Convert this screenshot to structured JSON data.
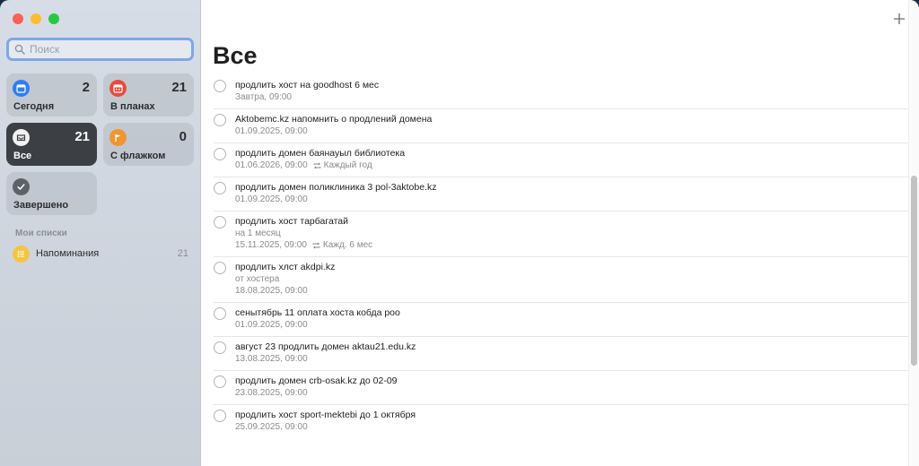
{
  "sidebar": {
    "search_placeholder": "Поиск",
    "cards": [
      {
        "key": "today",
        "label": "Сегодня",
        "count": "2",
        "icon": "calendar-today-icon",
        "color": "#2f7ef5"
      },
      {
        "key": "scheduled",
        "label": "В планах",
        "count": "21",
        "icon": "calendar-icon",
        "color": "#e84a3c"
      },
      {
        "key": "all",
        "label": "Все",
        "count": "21",
        "icon": "tray-icon",
        "color": "#555a60",
        "active": true
      },
      {
        "key": "flagged",
        "label": "С флажком",
        "count": "0",
        "icon": "flag-icon",
        "color": "#f0962e"
      },
      {
        "key": "completed",
        "label": "Завершено",
        "count": "",
        "icon": "checkmark-icon",
        "color": "#5d6168"
      }
    ],
    "my_lists_title": "Мои списки",
    "lists": [
      {
        "label": "Напоминания",
        "count": "21",
        "icon": "list-bullet-icon",
        "color": "#f4c542"
      }
    ]
  },
  "main": {
    "title": "Все",
    "add_icon": "plus-icon",
    "reminders": [
      {
        "title": "продлить хост на goodhost 6 мес",
        "note": "",
        "date": "Завтра, 09:00",
        "repeat": ""
      },
      {
        "title": "Aktobemc.kz напомнить о продлений домена",
        "note": "",
        "date": "01.09.2025, 09:00",
        "repeat": ""
      },
      {
        "title": "продлить домен баянауыл библиотека",
        "note": "",
        "date": "01.06.2026, 09:00",
        "repeat": "Каждый год"
      },
      {
        "title": "продлить домен поликлиника 3 pol-3aktobe.kz",
        "note": "",
        "date": "01.09.2025, 09:00",
        "repeat": ""
      },
      {
        "title": "продлить хост тарбагатай",
        "note": "на 1 месяц",
        "date": "15.11.2025, 09:00",
        "repeat": "Кажд. 6 мес"
      },
      {
        "title": "продлить хлст akdpi.kz",
        "note": "от хостера",
        "date": "18.08.2025, 09:00",
        "repeat": ""
      },
      {
        "title": "сенытябрь 11 оплата хоста кобда роо",
        "note": "",
        "date": "01.09.2025, 09:00",
        "repeat": ""
      },
      {
        "title": "август 23 продлить домен aktau21.edu.kz",
        "note": "",
        "date": "13.08.2025, 09:00",
        "repeat": ""
      },
      {
        "title": "продлить домен crb-osak.kz до 02-09",
        "note": "",
        "date": "23.08.2025, 09:00",
        "repeat": ""
      },
      {
        "title": "продлить хост sport-mektebi до 1 октября",
        "note": "",
        "date": "25.09.2025, 09:00",
        "repeat": ""
      }
    ]
  }
}
